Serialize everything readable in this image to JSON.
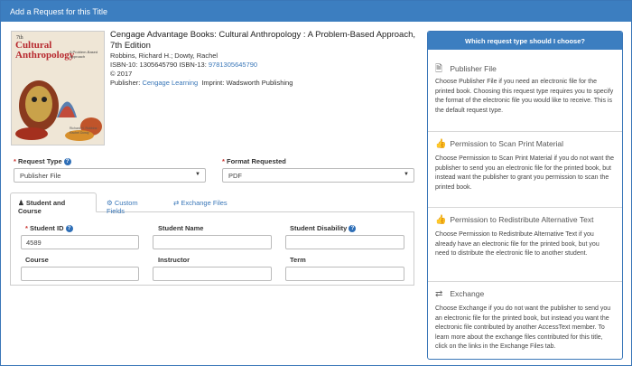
{
  "window": {
    "title": "Add a Request for this Title"
  },
  "book": {
    "cover": {
      "edition": "7th",
      "title": "Cultural Anthropology",
      "subtitle": "A Problem-Based Approach",
      "authors": "Richard H. Robbins · Rachel Dowty"
    },
    "title": "Cengage Advantage Books: Cultural Anthropology : A Problem-Based Approach, 7th Edition",
    "authors": "Robbins, Richard H.; Dowty, Rachel",
    "isbn10_label": "ISBN-10:",
    "isbn10": "1305645790",
    "isbn13_label": "ISBN-13:",
    "isbn13": "9781305645790",
    "copyright": "© 2017",
    "publisher_label": "Publisher:",
    "publisher": "Cengage Learning",
    "imprint_label": "Imprint:",
    "imprint": "Wadsworth Publishing"
  },
  "form": {
    "request_type_label": "Request Type",
    "request_type_value": "Publisher File",
    "format_label": "Format Requested",
    "format_value": "PDF"
  },
  "tabs": [
    {
      "label": "Student and Course",
      "icon": "user-icon",
      "active": true
    },
    {
      "label": "Custom Fields",
      "icon": "gear-icon",
      "active": false
    },
    {
      "label": "Exchange Files",
      "icon": "exchange-icon",
      "active": false
    }
  ],
  "fields": {
    "student_id_label": "Student ID",
    "student_id_value": "4589",
    "student_name_label": "Student Name",
    "student_name_value": "",
    "student_disability_label": "Student Disability",
    "student_disability_value": "",
    "course_label": "Course",
    "course_value": "",
    "instructor_label": "Instructor",
    "instructor_value": "",
    "term_label": "Term",
    "term_value": ""
  },
  "help_panel": {
    "title": "Which request type should I choose?",
    "options": [
      {
        "icon": "file-icon",
        "title": "Publisher File",
        "desc": "Choose Publisher File if you need an electronic file for the printed book. Choosing this request type requires you to specify the format of the electronic file you would like to receive. This is the default request type."
      },
      {
        "icon": "thumbs-up-icon",
        "title": "Permission to Scan Print Material",
        "desc": "Choose Permission to Scan Print Material if you do not want the publisher to send you an electronic file for the printed book, but instead want the publisher to grant you permission to scan the printed book."
      },
      {
        "icon": "thumbs-up-icon",
        "title": "Permission to Redistribute Alternative Text",
        "desc": "Choose Permission to Redistribute Alternative Text if you already have an electronic file for the printed book, but you need to distribute the electronic file to another student."
      },
      {
        "icon": "exchange-icon",
        "title": "Exchange",
        "desc": "Choose Exchange if you do not want the publisher to send you an electronic file for the printed book, but instead you want the electronic file contributed by another AccessText member. To learn more about the exchange files contributed for this title, click on the links in the Exchange Files tab."
      }
    ]
  },
  "colors": {
    "primary": "#3c7ec0",
    "link": "#3a77b8",
    "required": "#c9302c"
  }
}
